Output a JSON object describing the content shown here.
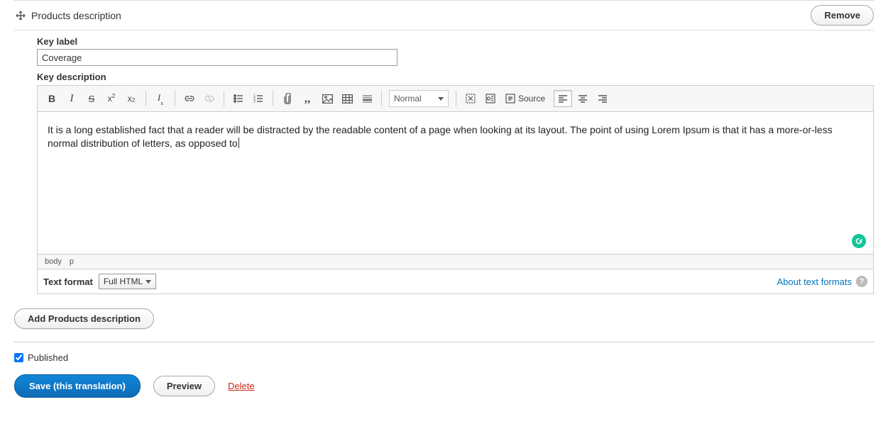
{
  "section": {
    "title": "Products description",
    "remove_label": "Remove"
  },
  "key_label": {
    "label": "Key label",
    "value": "Coverage"
  },
  "key_description": {
    "label": "Key description",
    "style_select": "Normal",
    "source_label": "Source",
    "body_text": "It is a long established fact that a reader will be distracted by the readable content of a page when looking at its layout. The point of using Lorem Ipsum is that it has a more-or-less normal distribution of letters, as opposed to",
    "path": {
      "el1": "body",
      "el2": "p"
    },
    "format_label": "Text format",
    "format_value": "Full HTML",
    "about_label": "About text formats"
  },
  "buttons": {
    "add": "Add Products description",
    "save": "Save (this translation)",
    "preview": "Preview",
    "delete": "Delete"
  },
  "published": {
    "label": "Published",
    "checked": true
  },
  "toolbar_icons": [
    "bold",
    "italic",
    "strike",
    "superscript",
    "subscript",
    "remove-format",
    "link",
    "unlink",
    "bullet-list",
    "number-list",
    "attachment",
    "blockquote",
    "image",
    "table",
    "hr",
    "style",
    "maximize",
    "show-blocks",
    "source",
    "align-left",
    "align-center",
    "align-right"
  ]
}
